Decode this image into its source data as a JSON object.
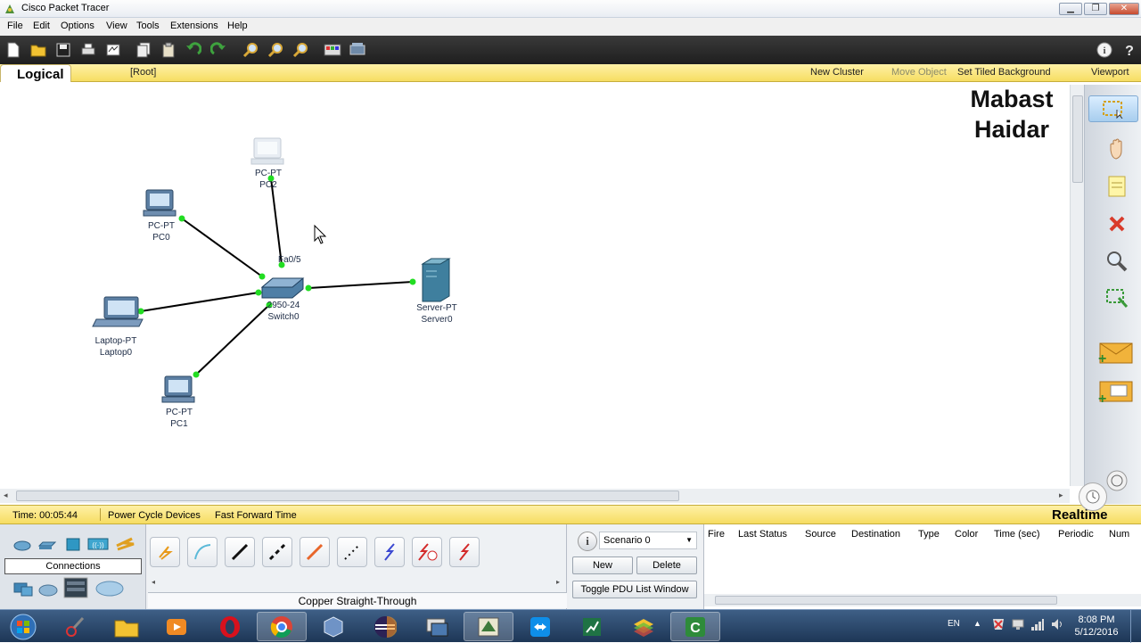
{
  "window": {
    "title": "Cisco Packet Tracer",
    "controls": [
      "minimize",
      "maximize",
      "close"
    ]
  },
  "menu": [
    "File",
    "Edit",
    "Options",
    "View",
    "Tools",
    "Extensions",
    "Help"
  ],
  "toolbar": {
    "icons": [
      "new-icon",
      "open-icon",
      "save-icon",
      "print-icon",
      "activity-wizard-icon",
      "copy-icon",
      "paste-icon",
      "undo-icon",
      "redo-icon",
      "zoom-in-icon",
      "zoom-reset-icon",
      "zoom-out-icon",
      "palette-icon",
      "custom-device-icon"
    ],
    "right_icons": [
      "info-icon",
      "help-icon"
    ]
  },
  "logical_bar": {
    "tab_label": "Logical",
    "root": "[Root]",
    "new_cluster": "New Cluster",
    "move_object": "Move Object",
    "set_tiled_background": "Set Tiled Background",
    "viewport": "Viewport"
  },
  "watermark": {
    "line1": "Mabast",
    "line2": "Haidar"
  },
  "devices": {
    "pc2": {
      "model": "PC-PT",
      "name": "PC2"
    },
    "pc0": {
      "model": "PC-PT",
      "name": "PC0"
    },
    "switch0": {
      "model": "2950-24",
      "name": "Switch0"
    },
    "server0": {
      "model": "Server-PT",
      "name": "Server0"
    },
    "laptop0": {
      "model": "Laptop-PT",
      "name": "Laptop0"
    },
    "pc1": {
      "model": "PC-PT",
      "name": "PC1"
    }
  },
  "port_label": "Fa0/5",
  "colors": {
    "link": "#000000",
    "link_up": "#22dd22",
    "yellow_bar": "#f6dd62",
    "taskbar": "#1d3656"
  },
  "right_tools": [
    "select-icon",
    "move-hand-icon",
    "note-icon",
    "delete-icon",
    "inspect-icon",
    "resize-icon",
    "add-simple-pdu-icon",
    "add-complex-pdu-icon"
  ],
  "status": {
    "time": "Time: 00:05:44",
    "power_cycle": "Power Cycle Devices",
    "fast_forward": "Fast Forward Time",
    "mode": "Realtime"
  },
  "device_panel": {
    "label": "Connections",
    "selected_cable": "Copper Straight-Through"
  },
  "scenario": {
    "selected": "Scenario 0",
    "new_label": "New",
    "delete_label": "Delete",
    "toggle_label": "Toggle PDU List Window"
  },
  "pdu_columns": [
    "Fire",
    "Last Status",
    "Source",
    "Destination",
    "Type",
    "Color",
    "Time (sec)",
    "Periodic",
    "Num"
  ],
  "taskbar": {
    "language": "EN",
    "time": "8:08 PM",
    "date": "5/12/2016",
    "apps": [
      "windows-start-icon",
      "snipping-tool-icon",
      "file-explorer-icon",
      "media-player-icon",
      "opera-icon",
      "chrome-icon",
      "virtualbox-icon",
      "eclipse-icon",
      "network-config-icon",
      "packet-tracer-icon",
      "teamviewer-icon",
      "excel-icon",
      "bluestacks-icon",
      "camtasia-icon"
    ]
  }
}
